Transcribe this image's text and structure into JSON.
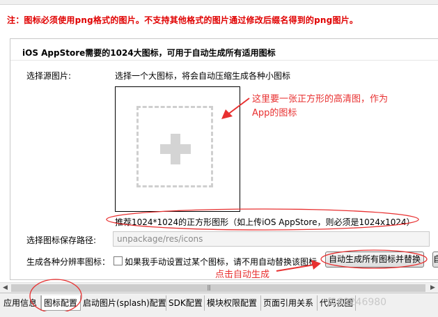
{
  "top": {
    "label": "图标配置"
  },
  "warning": "注：图标必须使用png格式的图片。不支持其他格式的图片通过修改后缀名得到的png图片。",
  "group": {
    "title": "iOS AppStore需要的1024大图标，可用于自动生成所有适用图标",
    "source_label": "选择源图片:",
    "source_hint": "选择一个大图标，将会自动压缩生成各种小图标",
    "recommend": "推荐1024*1024的正方形图形（如上传iOS AppStore，则必须是1024x1024）",
    "path_label": "选择图标保存路径:",
    "path_value": "unpackage/res/icons",
    "gen_label": "生成各种分辨率图标：",
    "manual_replace": "如果我手动设置过某个图标，请不用自动替换该图标",
    "auto_button": "自动生成所有图标并替换",
    "second_button": "自"
  },
  "annotations": {
    "square_line1": "这里要一张正方形的高清图，作为",
    "square_line2": "App的图标",
    "click_auto": "点击自动生成"
  },
  "tabs": [
    {
      "label": "应用信息",
      "active": false
    },
    {
      "label": "图标配置",
      "active": true
    },
    {
      "label": "启动图片(splash)配置",
      "active": false
    },
    {
      "label": "SDK配置",
      "active": false
    },
    {
      "label": "模块权限配置",
      "active": false
    },
    {
      "label": "页面引用关系",
      "active": false
    },
    {
      "label": "代码视图",
      "active": false
    }
  ],
  "watermark": "f368246980",
  "colors": {
    "annotation": "#e83030",
    "warning": "#e00000"
  }
}
